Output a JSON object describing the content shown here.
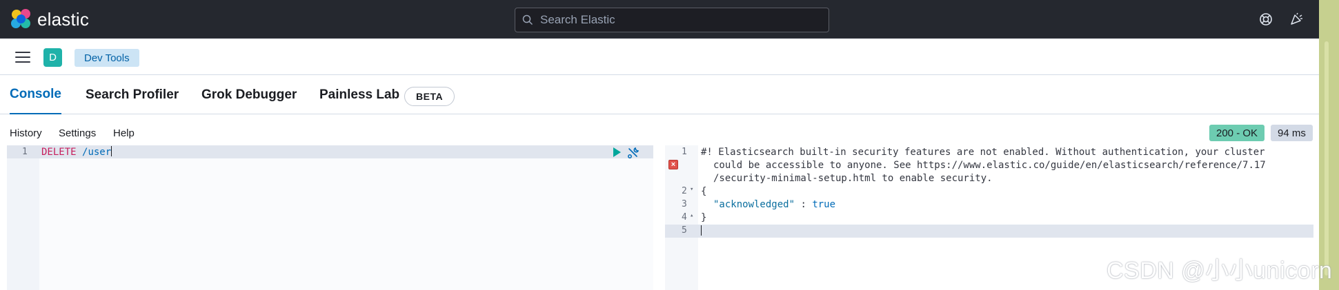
{
  "app": {
    "brand": "elastic",
    "search_placeholder": "Search Elastic",
    "help_icon": "lifebuoy-icon",
    "news_icon": "megaphone-icon"
  },
  "header": {
    "space_initial": "D",
    "breadcrumb": "Dev Tools"
  },
  "tabs": [
    {
      "label": "Console",
      "active": true
    },
    {
      "label": "Search Profiler",
      "active": false
    },
    {
      "label": "Grok Debugger",
      "active": false
    },
    {
      "label": "Painless Lab",
      "active": false
    }
  ],
  "beta_badge": "BETA",
  "console_menu": {
    "history": "History",
    "settings": "Settings",
    "help": "Help"
  },
  "status": {
    "code": "200 - OK",
    "time": "94 ms",
    "ok_color": "#6dccb1"
  },
  "request": {
    "line_number": "1",
    "method": "DELETE",
    "path": "/user"
  },
  "response": {
    "line_numbers": [
      "1",
      "2",
      "3",
      "4",
      "5"
    ],
    "warning_line1": "#! Elasticsearch built-in security features are not enabled. Without authentication, your cluster",
    "warning_line2": "could be accessible to anyone. See https://www.elastic.co/guide/en/elasticsearch/reference/7.17",
    "warning_line3": "/security-minimal-setup.html to enable security.",
    "open_brace": "{",
    "key": "\"acknowledged\"",
    "separator": " : ",
    "value": "true",
    "close_brace": "}"
  },
  "watermark": "CSDN @小小unicorn",
  "colors": {
    "topbar": "#25282f",
    "accent": "#006bb8",
    "breadcrumb_bg": "#cce4f5",
    "space_avatar": "#1fb2a9",
    "method": "#c61e5d"
  }
}
